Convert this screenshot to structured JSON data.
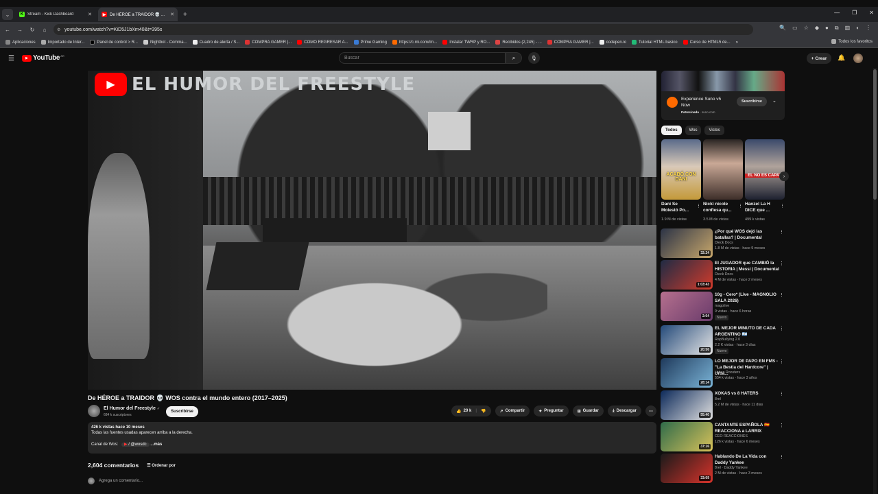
{
  "browser": {
    "tabs": [
      {
        "title": "Stream - Kick Dashboard",
        "icon": "K"
      },
      {
        "title": "De HÉROE a TRAIDOR 💀 ...",
        "icon": "▶"
      }
    ],
    "url": "youtube.com/watch?v=KiD5J1bXm40&t=395s",
    "bookmarks": [
      "Aplicaciones",
      "Importado de Inter...",
      "Panel de control > R...",
      "Nightbot - Comma...",
      "Cuadro de alerta / S...",
      "COMPRA GAMER |...",
      "COMO REGRESAR A...",
      "Prime Gaming",
      "https://c.mi.com//m...",
      "Instalar TWRP y RO...",
      "Recibidos (2,245) - ...",
      "COMPRA GAMER |...",
      "codepen.io",
      "Tutorial HTML basico",
      "Curso de HTML5 de..."
    ],
    "bookmarks_more": "»",
    "all_bookmarks": "Todos los favoritos"
  },
  "youtube": {
    "logo_text": "YouTube",
    "logo_country": "AR",
    "search_placeholder": "Buscar",
    "create_label": "Crear"
  },
  "video": {
    "brand_text": "EL HUMOR DEL FREESTYLE",
    "title": "De HÉROE a TRAIDOR 💀 WOS contra el mundo entero (2017–2025)",
    "channel": "El Humor del Freestyle",
    "channel_verified": "✓",
    "subscribers": "684 k suscriptores",
    "subscribe_label": "Suscribirse",
    "likes": "20 k",
    "share_label": "Compartir",
    "ask_label": "Preguntar",
    "save_label": "Guardar",
    "download_label": "Descargar",
    "views_meta": "426 k vistas  hace 10 meses",
    "description": "Todas las fuentes usadas aparecen arriba a la derecha.",
    "channel_line_label": "Canal de Wos:",
    "channel_line_handle": "/ @wosdc",
    "more_label": "...más",
    "comments_count": "2,604 comentarios",
    "sort_label": "Ordenar por",
    "add_comment_placeholder": "Agrega un comentario..."
  },
  "ad": {
    "title": "Experience Suno v5 Now",
    "sponsored": "Patrocinado",
    "domain": "suno.com",
    "button": "Suscribirse"
  },
  "chips": [
    "Todos",
    "Wos",
    "Vistos"
  ],
  "shorts": [
    {
      "title": "Dani Se Molestó Po...",
      "views": "1.9 M de vistas",
      "overlay": "ACABÓ CON DANI",
      "colors": [
        "#5a6b8a",
        "#d9c9b8",
        "#c49a3a"
      ]
    },
    {
      "title": "Nicki nicole confiesa qu...",
      "views": "3.5 M de vistas",
      "overlay": "",
      "colors": [
        "#2a2523",
        "#c9a896",
        "#3e2f2a"
      ]
    },
    {
      "title": "Hanzel La H DICE que ...",
      "views": "499 k vistas",
      "overlay": "EL NO ES CAPAZ",
      "colors": [
        "#3b4a6b",
        "#b0a39b",
        "#1d2130"
      ]
    }
  ],
  "recommended": [
    {
      "title": "¿Por qué WOS dejó las batallas? | Documental",
      "channel": "Dieck Docs",
      "views": "1.8 M de vistas · hace 9 meses",
      "duration": "32:24",
      "badge": "",
      "c1": "#2b3346",
      "c2": "#c8a76b"
    },
    {
      "title": "El JUGADOR que CAMBIÓ la HISTORIA | Messi | Documental",
      "channel": "Dieck Docs",
      "views": "4 M de vistas · hace 2 meses",
      "duration": "1:03:43",
      "badge": "",
      "c1": "#1f2b44",
      "c2": "#d23b2b"
    },
    {
      "title": "10g - Cero* (Live - MAGNOLIO SALA 2026)",
      "channel": "magolive",
      "views": "9 vistas · hace 6 horas",
      "duration": "2:04",
      "badge": "Nuevo",
      "c1": "#b5708e",
      "c2": "#6a3b6b"
    },
    {
      "title": "EL MEJOR MINUTO DE CADA ARGENTINO 🇦🇷",
      "channel": "RapBullying 2.0",
      "views": "2.2 K vistas · hace 3 días",
      "duration": "20:56",
      "badge": "Nuevo",
      "c1": "#244a7a",
      "c2": "#e5e5e5"
    },
    {
      "title": "LO MEJOR DE PAPO EN FMS - \"La Bestia del Hardcore\" | Urba...",
      "channel": "Urban Roosters",
      "views": "554 k vistas · hace 3 años",
      "duration": "28:14",
      "badge": "",
      "c1": "#1f3a5c",
      "c2": "#7ab3d6"
    },
    {
      "title": "XOKAS vs 8 HATERS",
      "channel": "8rel",
      "views": "5.2 M de vistas · hace 11 días",
      "duration": "55:40",
      "badge": "",
      "c1": "#0d2a5a",
      "c2": "#e0e0e0"
    },
    {
      "title": "CANTANTE ESPAÑOLA 🇪🇸 REACCIONA a LARRIX",
      "channel": "CEO REACCIONES",
      "views": "126 k vistas · hace 6 meses",
      "duration": "37:16",
      "badge": "",
      "c1": "#2f6b4a",
      "c2": "#d8c25a"
    },
    {
      "title": "Hablando De La Vida con Daddy Yankee",
      "channel": "8rel · Daddy Yankee",
      "views": "2 M de vistas · hace 3 meses",
      "duration": "33:09",
      "badge": "",
      "c1": "#1a1a1a",
      "c2": "#d6332b"
    }
  ]
}
